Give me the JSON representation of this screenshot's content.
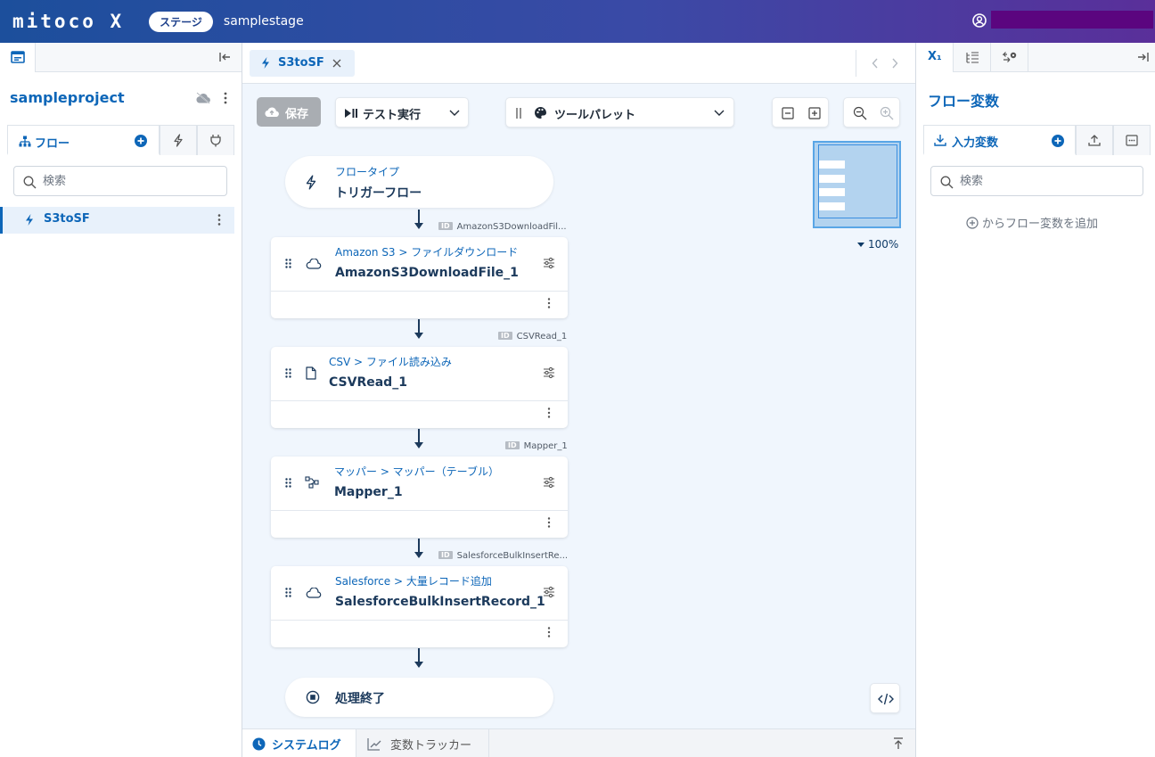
{
  "header": {
    "logo": "mitoco X",
    "stage_badge": "ステージ",
    "stage_name": "samplestage"
  },
  "left_panel": {
    "project_name": "sampleproject",
    "tabs": [
      {
        "label": "フロー",
        "icon": "flow-tree-icon"
      },
      {
        "label": "",
        "icon": "trigger-bolt-icon"
      },
      {
        "label": "",
        "icon": "plug-icon"
      }
    ],
    "search": {
      "placeholder": "検索"
    },
    "flows": [
      {
        "label": "S3toSF",
        "icon": "trigger-bolt-icon"
      }
    ]
  },
  "editor": {
    "open_tab": "S3toSF",
    "toolbar": {
      "save_label": "保存",
      "test_run_label": "テスト実行",
      "tool_palette_label": "ツールパレット",
      "zoom_level": "100%"
    },
    "flow": {
      "start": {
        "subtitle": "フロータイプ",
        "title": "トリガーフロー"
      },
      "nodes": [
        {
          "id_label": "AmazonS3DownloadFil...",
          "subtitle": "Amazon S3 > ファイルダウンロード",
          "title": "AmazonS3DownloadFile_1",
          "icon": "cloud-icon"
        },
        {
          "id_label": "CSVRead_1",
          "subtitle": "CSV > ファイル読み込み",
          "title": "CSVRead_1",
          "icon": "document-icon"
        },
        {
          "id_label": "Mapper_1",
          "subtitle": "マッパー > マッパー（テーブル）",
          "title": "Mapper_1",
          "icon": "mapper-icon"
        },
        {
          "id_label": "SalesforceBulkInsertRe...",
          "subtitle": "Salesforce > 大量レコード追加",
          "title": "SalesforceBulkInsertRecord_1",
          "icon": "cloud-icon"
        }
      ],
      "end": {
        "title": "処理終了"
      }
    },
    "bottom_tabs": [
      {
        "label": "システムログ",
        "active": true
      },
      {
        "label": "変数トラッカー",
        "active": false
      }
    ]
  },
  "right_panel": {
    "title": "フロー変数",
    "tab_variable_symbol": "X₁",
    "tabs": [
      {
        "label": "入力変数",
        "icon": "download-icon"
      },
      {
        "label": "",
        "icon": "upload-icon"
      },
      {
        "label": "",
        "icon": "ellipsis-box-icon"
      }
    ],
    "search": {
      "placeholder": "検索"
    },
    "add_variable_label": "からフロー変数を追加"
  },
  "colors": {
    "accent": "#0d66b8",
    "header_start": "#1c4f9c",
    "header_end": "#5a2f9a",
    "canvas": "#f0f6fd",
    "user_bar": "#5b057f"
  }
}
